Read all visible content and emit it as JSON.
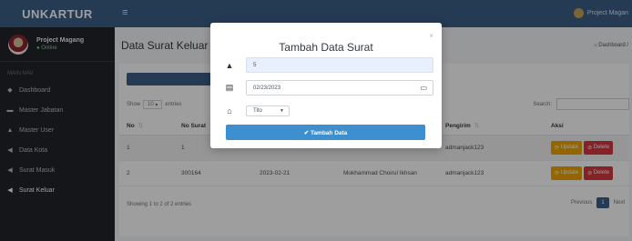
{
  "app": {
    "brand": "UNKARTUR"
  },
  "user": {
    "name": "Project Magang",
    "status": "● Online",
    "top_name": "Project Magan"
  },
  "sidebar": {
    "header": "MAIN NAV",
    "items": [
      {
        "icon": "dashboard-icon",
        "glyph": "◆",
        "label": "Dashboard"
      },
      {
        "icon": "briefcase-icon",
        "glyph": "▬",
        "label": "Master Jabatan"
      },
      {
        "icon": "user-icon",
        "glyph": "▲",
        "label": "Master User"
      },
      {
        "icon": "send-icon",
        "glyph": "◀",
        "label": "Data Kota"
      },
      {
        "icon": "send-icon",
        "glyph": "◀",
        "label": "Surat Masuk"
      },
      {
        "icon": "send-icon",
        "glyph": "◀",
        "label": "Surat Keluar"
      }
    ]
  },
  "header": {
    "burger": "≡"
  },
  "page": {
    "title": "Data Surat Keluar",
    "breadcrumb": "⌂ Dashboard  /"
  },
  "table_controls": {
    "show": "Show",
    "entries_value": "10",
    "entries": "entries",
    "search": "Search:"
  },
  "table": {
    "columns": [
      "No",
      "No Surat",
      "",
      "",
      "Pengirim",
      "Aksi"
    ],
    "rows": [
      {
        "no": "1",
        "no_surat": "1",
        "date": "",
        "name": "",
        "sender": "admanjack123"
      },
      {
        "no": "2",
        "no_surat": "300164",
        "date": "2023-02-21",
        "name": "Mokhammad Choirul Ikhsan",
        "sender": "admanjack123"
      }
    ],
    "update_label": "Update",
    "delete_label": "Delete"
  },
  "footer": {
    "showing": "Showing 1 to 2 of 2 entries",
    "previous": "Previous",
    "page": "1",
    "next": "Next"
  },
  "modal": {
    "title": "Tambah Data Surat",
    "close": "×",
    "field1_value": "5",
    "date_value": "02/23/2023",
    "select_value": "Tito",
    "submit_label": "✔ Tambah Data"
  },
  "colors": {
    "primary": "#3b5f87",
    "update": "#f0a500",
    "delete": "#d9363e",
    "submit": "#3e8fd0"
  }
}
